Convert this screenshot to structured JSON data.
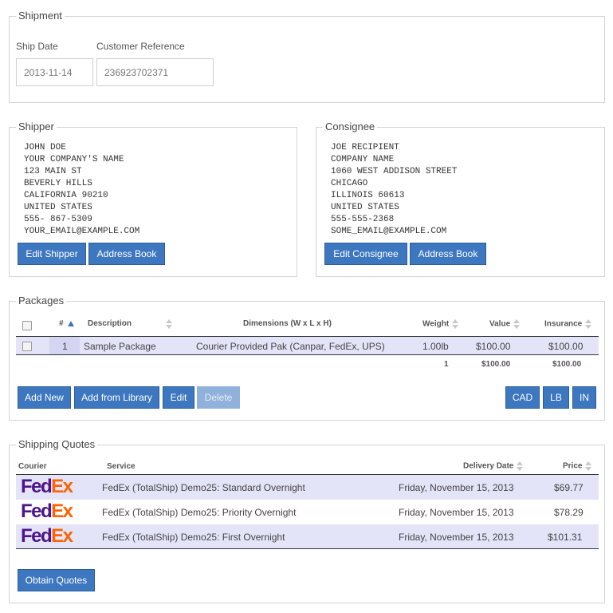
{
  "shipment": {
    "legend": "Shipment",
    "ship_date_label": "Ship Date",
    "ship_date_value": "2013-11-14",
    "customer_ref_label": "Customer Reference",
    "customer_ref_value": "236923702371"
  },
  "shipper": {
    "legend": "Shipper",
    "lines": [
      "JOHN DOE",
      "YOUR COMPANY'S NAME",
      "123 MAIN ST",
      "BEVERLY HILLS",
      "CALIFORNIA 90210",
      "UNITED STATES",
      "555- 867-5309",
      "YOUR_EMAIL@EXAMPLE.COM"
    ],
    "edit_button": "Edit Shipper",
    "address_book_button": "Address Book"
  },
  "consignee": {
    "legend": "Consignee",
    "lines": [
      "JOE RECIPIENT",
      "COMPANY NAME",
      "1060 WEST ADDISON STREET",
      "CHICAGO",
      "ILLINOIS 60613",
      "UNITED STATES",
      "555-555-2368",
      "SOME_EMAIL@EXAMPLE.COM"
    ],
    "edit_button": "Edit Consignee",
    "address_book_button": "Address Book"
  },
  "packages": {
    "legend": "Packages",
    "columns": {
      "num": "#",
      "description": "Description",
      "dimensions": "Dimensions (W x L x H)",
      "weight": "Weight",
      "value": "Value",
      "insurance": "Insurance"
    },
    "rows": [
      {
        "num": "1",
        "description": "Sample Package",
        "dimensions": "Courier Provided Pak (Canpar, FedEx, UPS)",
        "weight": "1.00lb",
        "value": "$100.00",
        "insurance": "$100.00"
      }
    ],
    "totals": {
      "count": "1",
      "value": "$100.00",
      "insurance": "$100.00"
    },
    "buttons": {
      "add_new": "Add New",
      "add_from_library": "Add from Library",
      "edit": "Edit",
      "delete": "Delete",
      "cad": "CAD",
      "lb": "LB",
      "in": "IN"
    }
  },
  "quotes": {
    "legend": "Shipping Quotes",
    "columns": {
      "courier": "Courier",
      "service": "Service",
      "delivery_date": "Delivery Date",
      "price": "Price"
    },
    "rows": [
      {
        "logo_fe": "Fed",
        "logo_ex": "Ex",
        "service": "FedEx (TotalShip) Demo25: Standard Overnight",
        "delivery_date": "Friday, November 15, 2013",
        "price": "$69.77"
      },
      {
        "logo_fe": "Fed",
        "logo_ex": "Ex",
        "service": "FedEx (TotalShip) Demo25: Priority Overnight",
        "delivery_date": "Friday, November 15, 2013",
        "price": "$78.29"
      },
      {
        "logo_fe": "Fed",
        "logo_ex": "Ex",
        "service": "FedEx (TotalShip) Demo25: First Overnight",
        "delivery_date": "Friday, November 15, 2013",
        "price": "$101.31"
      }
    ],
    "obtain_button": "Obtain Quotes"
  },
  "colors": {
    "button_blue": "#3d77bf",
    "row_highlight": "#e3e3fa",
    "fedex_purple": "#4d148c",
    "fedex_orange": "#ff6200"
  },
  "icons": {
    "sort": "sort-both-icon",
    "sort_asc": "sort-asc-icon",
    "checkbox": "checkbox-icon"
  }
}
